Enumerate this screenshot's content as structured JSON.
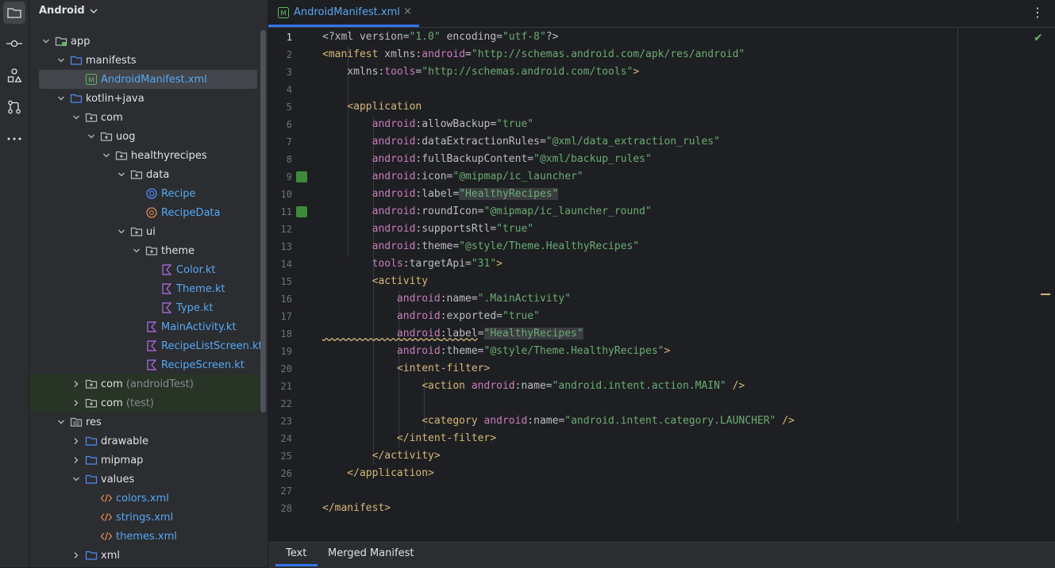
{
  "sidebar_tools": [
    "project-icon",
    "commit-icon",
    "structure-icon",
    "branches-icon",
    "more-icon"
  ],
  "panel": {
    "title": "Android",
    "tree": [
      {
        "label": "app",
        "depth": 0,
        "icon": "module-folder-icon",
        "open": true
      },
      {
        "label": "manifests",
        "depth": 1,
        "icon": "folder-icon",
        "open": true
      },
      {
        "label": "AndroidManifest.xml",
        "depth": 2,
        "icon": "manifest-file-icon",
        "file": true,
        "selected": true
      },
      {
        "label": "kotlin+java",
        "depth": 1,
        "icon": "folder-icon",
        "open": true
      },
      {
        "label": "com",
        "depth": 2,
        "icon": "package-icon",
        "open": true
      },
      {
        "label": "uog",
        "depth": 3,
        "icon": "package-icon",
        "open": true
      },
      {
        "label": "healthyrecipes",
        "depth": 4,
        "icon": "package-icon",
        "open": true
      },
      {
        "label": "data",
        "depth": 5,
        "icon": "package-icon",
        "open": true
      },
      {
        "label": "Recipe",
        "depth": 6,
        "icon": "data-class-icon",
        "file": true
      },
      {
        "label": "RecipeData",
        "depth": 6,
        "icon": "object-icon",
        "file": true
      },
      {
        "label": "ui",
        "depth": 5,
        "icon": "package-icon",
        "open": true
      },
      {
        "label": "theme",
        "depth": 6,
        "icon": "package-icon",
        "open": true
      },
      {
        "label": "Color.kt",
        "depth": 7,
        "icon": "kotlin-file-icon",
        "file": true
      },
      {
        "label": "Theme.kt",
        "depth": 7,
        "icon": "kotlin-file-icon",
        "file": true
      },
      {
        "label": "Type.kt",
        "depth": 7,
        "icon": "kotlin-file-icon",
        "file": true
      },
      {
        "label": "MainActivity.kt",
        "depth": 6,
        "icon": "kotlin-file-icon",
        "file": true
      },
      {
        "label": "RecipeListScreen.kt",
        "depth": 6,
        "icon": "kotlin-file-icon",
        "file": true
      },
      {
        "label": "RecipeScreen.kt",
        "depth": 6,
        "icon": "kotlin-file-icon",
        "file": true
      },
      {
        "label": "com",
        "suffix": "(androidTest)",
        "depth": 2,
        "icon": "package-icon",
        "open": false,
        "green": true
      },
      {
        "label": "com",
        "suffix": "(test)",
        "depth": 2,
        "icon": "package-icon",
        "open": false,
        "green": true
      },
      {
        "label": "res",
        "depth": 1,
        "icon": "res-folder-icon",
        "open": true
      },
      {
        "label": "drawable",
        "depth": 2,
        "icon": "folder-icon",
        "open": false
      },
      {
        "label": "mipmap",
        "depth": 2,
        "icon": "folder-icon",
        "open": false
      },
      {
        "label": "values",
        "depth": 2,
        "icon": "folder-icon",
        "open": true
      },
      {
        "label": "colors.xml",
        "depth": 3,
        "icon": "xml-file-icon",
        "file": true
      },
      {
        "label": "strings.xml",
        "depth": 3,
        "icon": "xml-file-icon",
        "file": true
      },
      {
        "label": "themes.xml",
        "depth": 3,
        "icon": "xml-file-icon",
        "file": true
      },
      {
        "label": "xml",
        "depth": 2,
        "icon": "folder-icon",
        "open": false
      }
    ]
  },
  "editor": {
    "tab_label": "AndroidManifest.xml",
    "current_line": 1,
    "lines": [
      [
        [
          "an",
          "<?xml version="
        ],
        [
          "v",
          "\"1.0\""
        ],
        [
          "an",
          " encoding="
        ],
        [
          "v",
          "\"utf-8\""
        ],
        [
          "an",
          "?>"
        ]
      ],
      [
        [
          "t",
          "<manifest "
        ],
        [
          "an",
          "xmlns:"
        ],
        [
          "a",
          "android"
        ],
        [
          "an",
          "="
        ],
        [
          "v",
          "\"http://schemas.android.com/apk/res/android\""
        ]
      ],
      [
        [
          "an",
          "    xmlns:"
        ],
        [
          "a",
          "tools"
        ],
        [
          "an",
          "="
        ],
        [
          "v",
          "\"http://schemas.android.com/tools\""
        ],
        [
          "t",
          ">"
        ]
      ],
      [],
      [
        [
          "t",
          "    <application"
        ]
      ],
      [
        [
          "a",
          "        android"
        ],
        [
          "an",
          ":allowBackup="
        ],
        [
          "v",
          "\"true\""
        ]
      ],
      [
        [
          "a",
          "        android"
        ],
        [
          "an",
          ":dataExtractionRules="
        ],
        [
          "v",
          "\"@xml/data_extraction_rules\""
        ]
      ],
      [
        [
          "a",
          "        android"
        ],
        [
          "an",
          ":fullBackupContent="
        ],
        [
          "v",
          "\"@xml/backup_rules\""
        ]
      ],
      [
        [
          "a",
          "        android"
        ],
        [
          "an",
          ":icon="
        ],
        [
          "v",
          "\"@mipmap/ic_launcher\""
        ]
      ],
      [
        [
          "a",
          "        android"
        ],
        [
          "an",
          ":label="
        ],
        [
          "hl",
          "\"HealthyRecipes\""
        ]
      ],
      [
        [
          "a",
          "        android"
        ],
        [
          "an",
          ":roundIcon="
        ],
        [
          "v",
          "\"@mipmap/ic_launcher_round\""
        ]
      ],
      [
        [
          "a",
          "        android"
        ],
        [
          "an",
          ":supportsRtl="
        ],
        [
          "v",
          "\"true\""
        ]
      ],
      [
        [
          "a",
          "        android"
        ],
        [
          "an",
          ":theme="
        ],
        [
          "v",
          "\"@style/Theme.HealthyRecipes\""
        ]
      ],
      [
        [
          "a",
          "        tools"
        ],
        [
          "an",
          ":targetApi="
        ],
        [
          "v",
          "\"31\""
        ],
        [
          "t",
          ">"
        ]
      ],
      [
        [
          "t",
          "        <activity"
        ]
      ],
      [
        [
          "a",
          "            android"
        ],
        [
          "an",
          ":name="
        ],
        [
          "v",
          "\".MainActivity\""
        ]
      ],
      [
        [
          "a",
          "            android"
        ],
        [
          "an",
          ":exported="
        ],
        [
          "v",
          "\"true\""
        ]
      ],
      [
        [
          "aw",
          "            android"
        ],
        [
          "anw",
          ":label"
        ],
        [
          "an",
          "="
        ],
        [
          "hl",
          "\"HealthyRecipes\""
        ]
      ],
      [
        [
          "a",
          "            android"
        ],
        [
          "an",
          ":theme="
        ],
        [
          "v",
          "\"@style/Theme.HealthyRecipes\""
        ],
        [
          "t",
          ">"
        ]
      ],
      [
        [
          "t",
          "            <intent-filter>"
        ]
      ],
      [
        [
          "t",
          "                <action "
        ],
        [
          "a",
          "android"
        ],
        [
          "an",
          ":name="
        ],
        [
          "v",
          "\"android.intent.action.MAIN\""
        ],
        [
          "t",
          " />"
        ]
      ],
      [],
      [
        [
          "t",
          "                <category "
        ],
        [
          "a",
          "android"
        ],
        [
          "an",
          ":name="
        ],
        [
          "v",
          "\"android.intent.category.LAUNCHER\""
        ],
        [
          "t",
          " />"
        ]
      ],
      [
        [
          "t",
          "            </intent-filter>"
        ]
      ],
      [
        [
          "t",
          "        </activity>"
        ]
      ],
      [
        [
          "t",
          "    </application>"
        ]
      ],
      [],
      [
        [
          "t",
          "</manifest>"
        ]
      ]
    ],
    "gutter_icons": [
      9,
      11
    ]
  },
  "bottom_tabs": [
    "Text",
    "Merged Manifest"
  ],
  "colors": {
    "accent": "#3574f0",
    "tag": "#d5b778",
    "attr": "#c77dbb",
    "value": "#6aab73"
  }
}
